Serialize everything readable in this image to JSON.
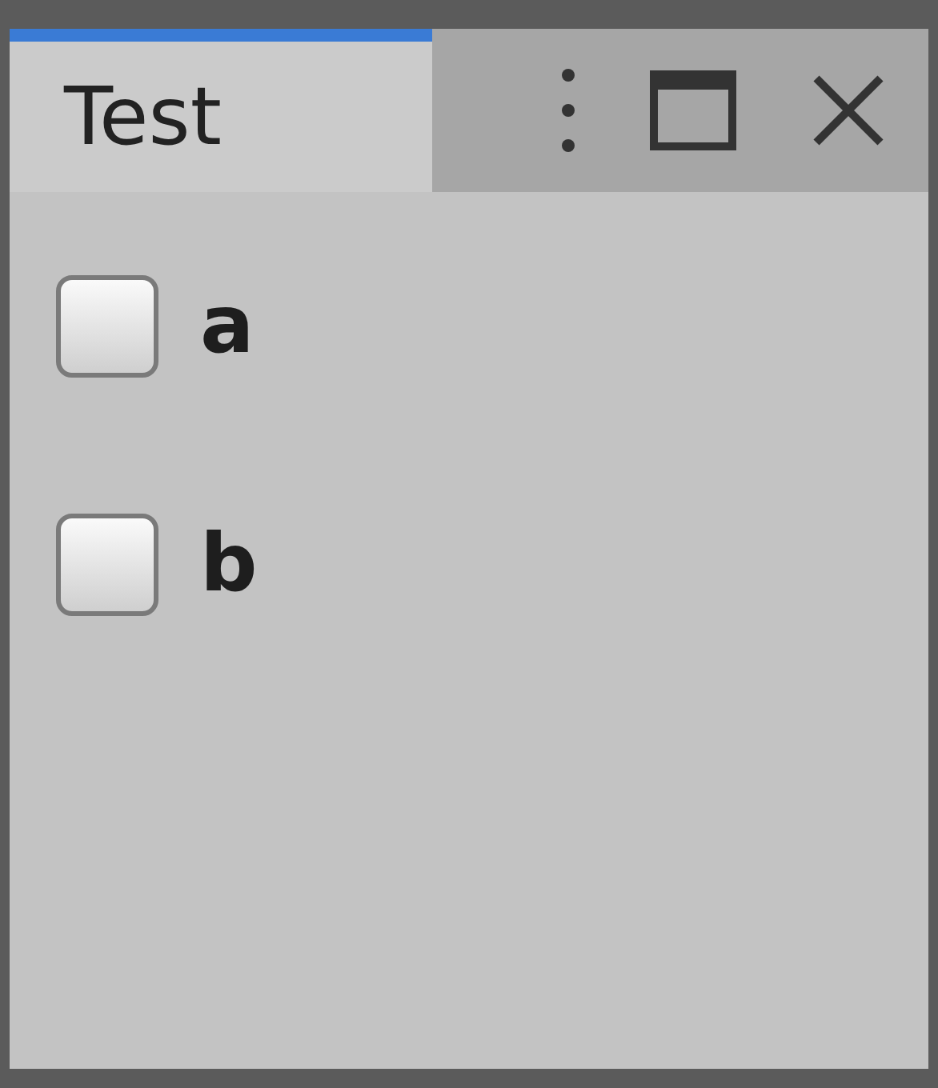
{
  "tab": {
    "label": "Test",
    "selected": true
  },
  "toggles": [
    {
      "label": "a",
      "checked": false
    },
    {
      "label": "b",
      "checked": false
    }
  ]
}
